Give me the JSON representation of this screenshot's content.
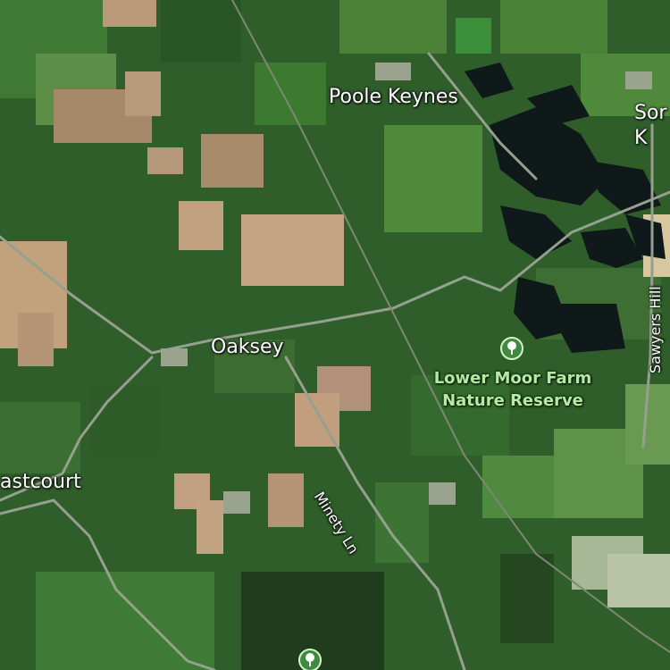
{
  "map": {
    "colors": {
      "field_dark": "#2c5a26",
      "field_mid": "#3f7a33",
      "field_light": "#5a8f46",
      "field_tan": "#b89a72",
      "water": "#101a1a",
      "road": "#8e9a8a",
      "poi_green": "#b7e8a4"
    },
    "places": [
      {
        "id": "poole-keynes",
        "label": "Poole Keynes"
      },
      {
        "id": "somerford-keynes",
        "label": "Sor\nK"
      },
      {
        "id": "oaksey",
        "label": "Oaksey"
      },
      {
        "id": "eastcourt",
        "label": "astcourt"
      }
    ],
    "roads": [
      {
        "id": "minety-ln",
        "label": "Minety Ln"
      },
      {
        "id": "sawyers-hill",
        "label": "Sawyers Hill"
      }
    ],
    "pois": [
      {
        "id": "lower-moor-farm",
        "label_line1": "Lower Moor Farm",
        "label_line2": "Nature Reserve",
        "icon": "tree-icon"
      },
      {
        "id": "bottom-poi",
        "icon": "tree-icon"
      }
    ]
  }
}
